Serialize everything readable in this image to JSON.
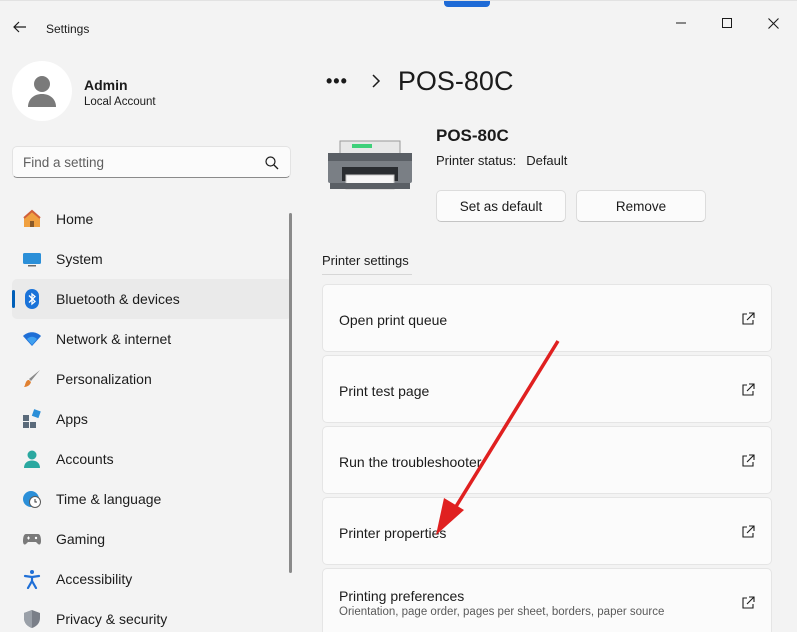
{
  "window": {
    "title": "Settings"
  },
  "profile": {
    "name": "Admin",
    "account_type": "Local Account"
  },
  "search": {
    "placeholder": "Find a setting"
  },
  "nav": {
    "items": [
      {
        "label": "Home",
        "icon": "home-icon"
      },
      {
        "label": "System",
        "icon": "system-icon"
      },
      {
        "label": "Bluetooth & devices",
        "icon": "bluetooth-icon",
        "active": true
      },
      {
        "label": "Network & internet",
        "icon": "wifi-icon"
      },
      {
        "label": "Personalization",
        "icon": "brush-icon"
      },
      {
        "label": "Apps",
        "icon": "apps-icon"
      },
      {
        "label": "Accounts",
        "icon": "accounts-icon"
      },
      {
        "label": "Time & language",
        "icon": "clock-globe-icon"
      },
      {
        "label": "Gaming",
        "icon": "gamepad-icon"
      },
      {
        "label": "Accessibility",
        "icon": "accessibility-icon"
      },
      {
        "label": "Privacy & security",
        "icon": "shield-icon"
      }
    ]
  },
  "breadcrumb": {
    "more": "•••",
    "current": "POS-80C"
  },
  "printer": {
    "name": "POS-80C",
    "status_label": "Printer status:",
    "status_value": "Default",
    "set_default_label": "Set as default",
    "remove_label": "Remove"
  },
  "printer_settings": {
    "section_title": "Printer settings",
    "items": [
      {
        "title": "Open print queue",
        "subtitle": ""
      },
      {
        "title": "Print test page",
        "subtitle": ""
      },
      {
        "title": "Run the troubleshooter",
        "subtitle": ""
      },
      {
        "title": "Printer properties",
        "subtitle": ""
      },
      {
        "title": "Printing preferences",
        "subtitle": "Orientation, page order, pages per sheet, borders, paper source"
      }
    ]
  },
  "colors": {
    "accent": "#005fb8",
    "annotation_arrow": "#e02020"
  }
}
